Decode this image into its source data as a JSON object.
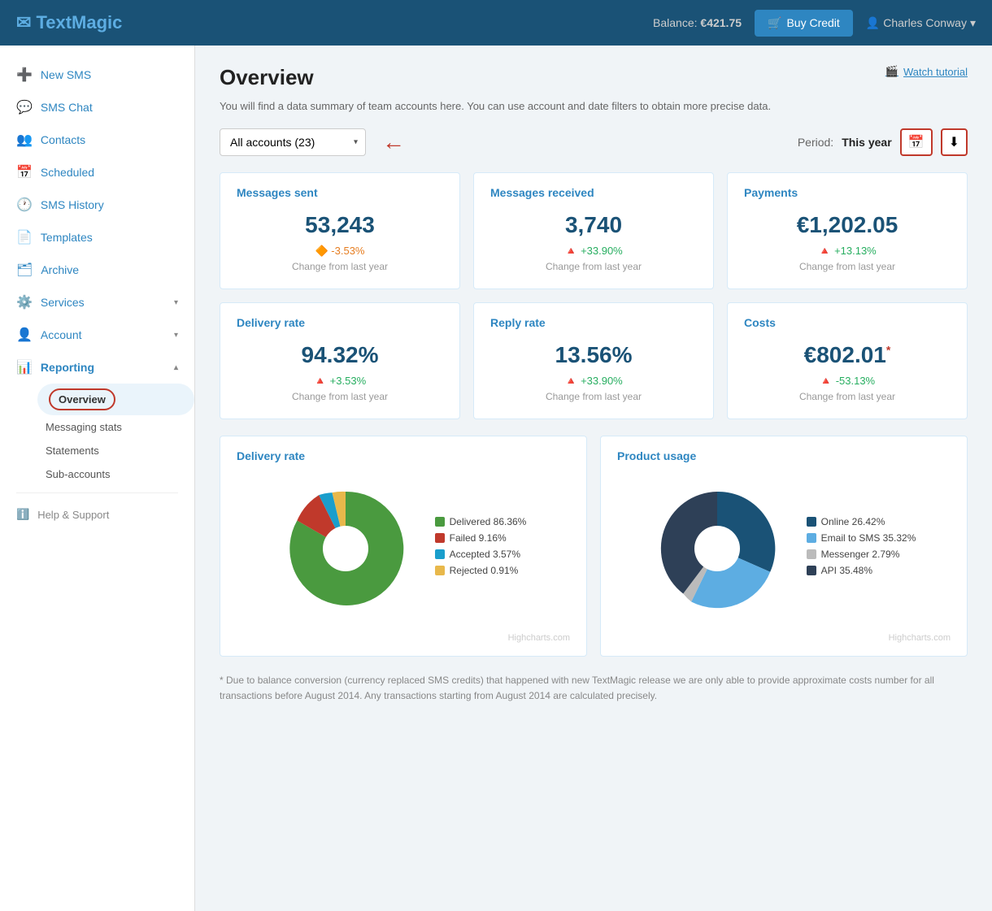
{
  "header": {
    "logo": "TextMagic",
    "balance_label": "Balance:",
    "balance_value": "€421.75",
    "buy_credit_label": "Buy Credit",
    "user_name": "Charles Conway",
    "user_icon": "👤"
  },
  "sidebar": {
    "items": [
      {
        "id": "new-sms",
        "label": "New SMS",
        "icon": "➕",
        "has_arrow": false
      },
      {
        "id": "sms-chat",
        "label": "SMS Chat",
        "icon": "💬",
        "has_arrow": false
      },
      {
        "id": "contacts",
        "label": "Contacts",
        "icon": "👥",
        "has_arrow": false
      },
      {
        "id": "scheduled",
        "label": "Scheduled",
        "icon": "📅",
        "has_arrow": false
      },
      {
        "id": "sms-history",
        "label": "SMS History",
        "icon": "🕐",
        "has_arrow": false
      },
      {
        "id": "templates",
        "label": "Templates",
        "icon": "📄",
        "has_arrow": false
      },
      {
        "id": "archive",
        "label": "Archive",
        "icon": "🗂",
        "has_arrow": false
      },
      {
        "id": "services",
        "label": "Services",
        "icon": "⚙️",
        "has_arrow": true
      },
      {
        "id": "account",
        "label": "Account",
        "icon": "👤",
        "has_arrow": true
      },
      {
        "id": "reporting",
        "label": "Reporting",
        "icon": "📊",
        "has_arrow": true,
        "active": true
      }
    ],
    "reporting_sub": [
      {
        "id": "overview",
        "label": "Overview",
        "active": true
      },
      {
        "id": "messaging-stats",
        "label": "Messaging stats",
        "active": false
      },
      {
        "id": "statements",
        "label": "Statements",
        "active": false
      },
      {
        "id": "sub-accounts",
        "label": "Sub-accounts",
        "active": false
      }
    ],
    "help_label": "Help & Support"
  },
  "page": {
    "title": "Overview",
    "description": "You will find a data summary of team accounts here. You can use account and date filters to obtain more precise data.",
    "watch_tutorial": "Watch tutorial"
  },
  "filters": {
    "account_select_value": "All accounts (23)",
    "period_label": "Period:",
    "period_value": "This year"
  },
  "stats": [
    {
      "title": "Messages sent",
      "value": "53,243",
      "change": "-3.53%",
      "change_type": "negative",
      "change_icon": "🔶",
      "sublabel": "Change from last year"
    },
    {
      "title": "Messages received",
      "value": "3,740",
      "change": "+33.90%",
      "change_type": "positive",
      "change_icon": "🔺",
      "sublabel": "Change from last year"
    },
    {
      "title": "Payments",
      "value": "€1,202.05",
      "change": "+13.13%",
      "change_type": "positive",
      "change_icon": "🔺",
      "sublabel": "Change from last year"
    },
    {
      "title": "Delivery rate",
      "value": "94.32%",
      "change": "+3.53%",
      "change_type": "positive",
      "change_icon": "🔺",
      "sublabel": "Change from last year"
    },
    {
      "title": "Reply rate",
      "value": "13.56%",
      "change": "+33.90%",
      "change_type": "positive",
      "change_icon": "🔺",
      "sublabel": "Change from last year"
    },
    {
      "title": "Costs",
      "value": "€802.01",
      "asterisk": true,
      "change": "-53.13%",
      "change_type": "positive",
      "change_icon": "🔺",
      "sublabel": "Change from last year"
    }
  ],
  "delivery_chart": {
    "title": "Delivery rate",
    "legend": [
      {
        "label": "Delivered",
        "value": "86.36%",
        "color": "#4a9a3f"
      },
      {
        "label": "Failed",
        "value": "9.16%",
        "color": "#c0392b"
      },
      {
        "label": "Accepted",
        "value": "3.57%",
        "color": "#1a9ecc"
      },
      {
        "label": "Rejected",
        "value": "0.91%",
        "color": "#e8b84b"
      }
    ],
    "highcharts": "Highcharts.com"
  },
  "product_chart": {
    "title": "Product usage",
    "legend": [
      {
        "label": "Online",
        "value": "26.42%",
        "color": "#1a5276"
      },
      {
        "label": "Email to SMS",
        "value": "35.32%",
        "color": "#5dade2"
      },
      {
        "label": "Messenger",
        "value": "2.79%",
        "color": "#bbb"
      },
      {
        "label": "API",
        "value": "35.48%",
        "color": "#2e4057"
      }
    ],
    "highcharts": "Highcharts.com"
  },
  "footer_note": "* Due to balance conversion (currency replaced SMS credits) that happened with new TextMagic release we are only able to provide approximate costs number for all transactions before August 2014. Any transactions starting from August 2014 are calculated precisely."
}
